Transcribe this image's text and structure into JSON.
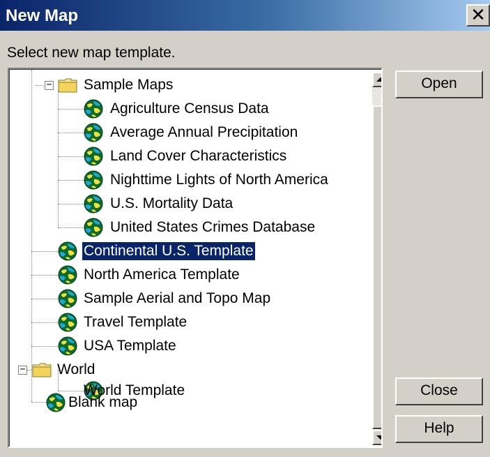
{
  "window": {
    "title": "New Map",
    "close_glyph": "✕"
  },
  "instruction": "Select new map template.",
  "tree": {
    "nodes": [
      {
        "label": "Sample Maps",
        "icon": "folder-icon",
        "expanded": true
      },
      {
        "label": "Agriculture Census Data",
        "icon": "globe-map-icon"
      },
      {
        "label": "Average Annual Precipitation",
        "icon": "globe-map-icon"
      },
      {
        "label": "Land Cover Characteristics",
        "icon": "globe-map-icon"
      },
      {
        "label": "Nighttime Lights of North America",
        "icon": "globe-map-icon"
      },
      {
        "label": "U.S. Mortality Data",
        "icon": "globe-map-icon"
      },
      {
        "label": "United States Crimes Database",
        "icon": "globe-map-icon"
      },
      {
        "label": "Continental U.S. Template",
        "icon": "globe-map-icon",
        "selected": true
      },
      {
        "label": "North America Template",
        "icon": "globe-map-icon"
      },
      {
        "label": "Sample Aerial and Topo Map",
        "icon": "globe-map-icon"
      },
      {
        "label": "Travel Template",
        "icon": "globe-map-icon"
      },
      {
        "label": "USA Template",
        "icon": "globe-map-icon"
      },
      {
        "label": "World",
        "icon": "folder-icon",
        "expanded": true
      },
      {
        "label": "World Template",
        "icon": "globe-map-icon"
      },
      {
        "label": "Blank map",
        "icon": "globe-map-icon"
      }
    ]
  },
  "buttons": {
    "open": "Open",
    "close": "Close",
    "help": "Help"
  },
  "colors": {
    "selection": "#0a246a",
    "title_bar": "#0a246a",
    "dialog_bg": "#d4d0c8"
  }
}
